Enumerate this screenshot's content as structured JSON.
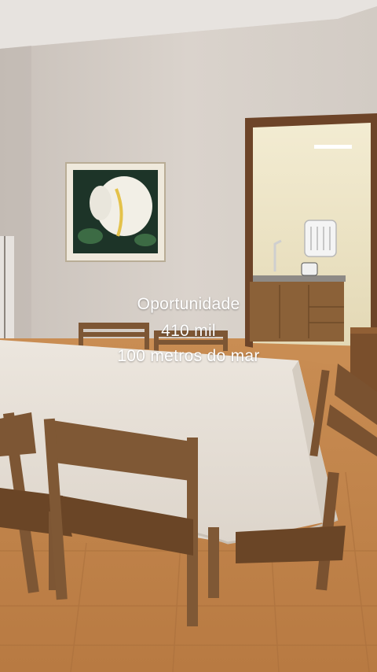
{
  "overlay": {
    "line1": "Oportunidade",
    "line2": "410 mil",
    "line3": "100 metros do mar"
  },
  "colors": {
    "wall": "#d8d1ca",
    "ceiling": "#e6e1dc",
    "floor": "#c98c4f",
    "wood": "#8a5a33",
    "tablecloth": "#e9e2d9",
    "kitchen_tile": "#ece4c6",
    "text": "#ffffff"
  }
}
